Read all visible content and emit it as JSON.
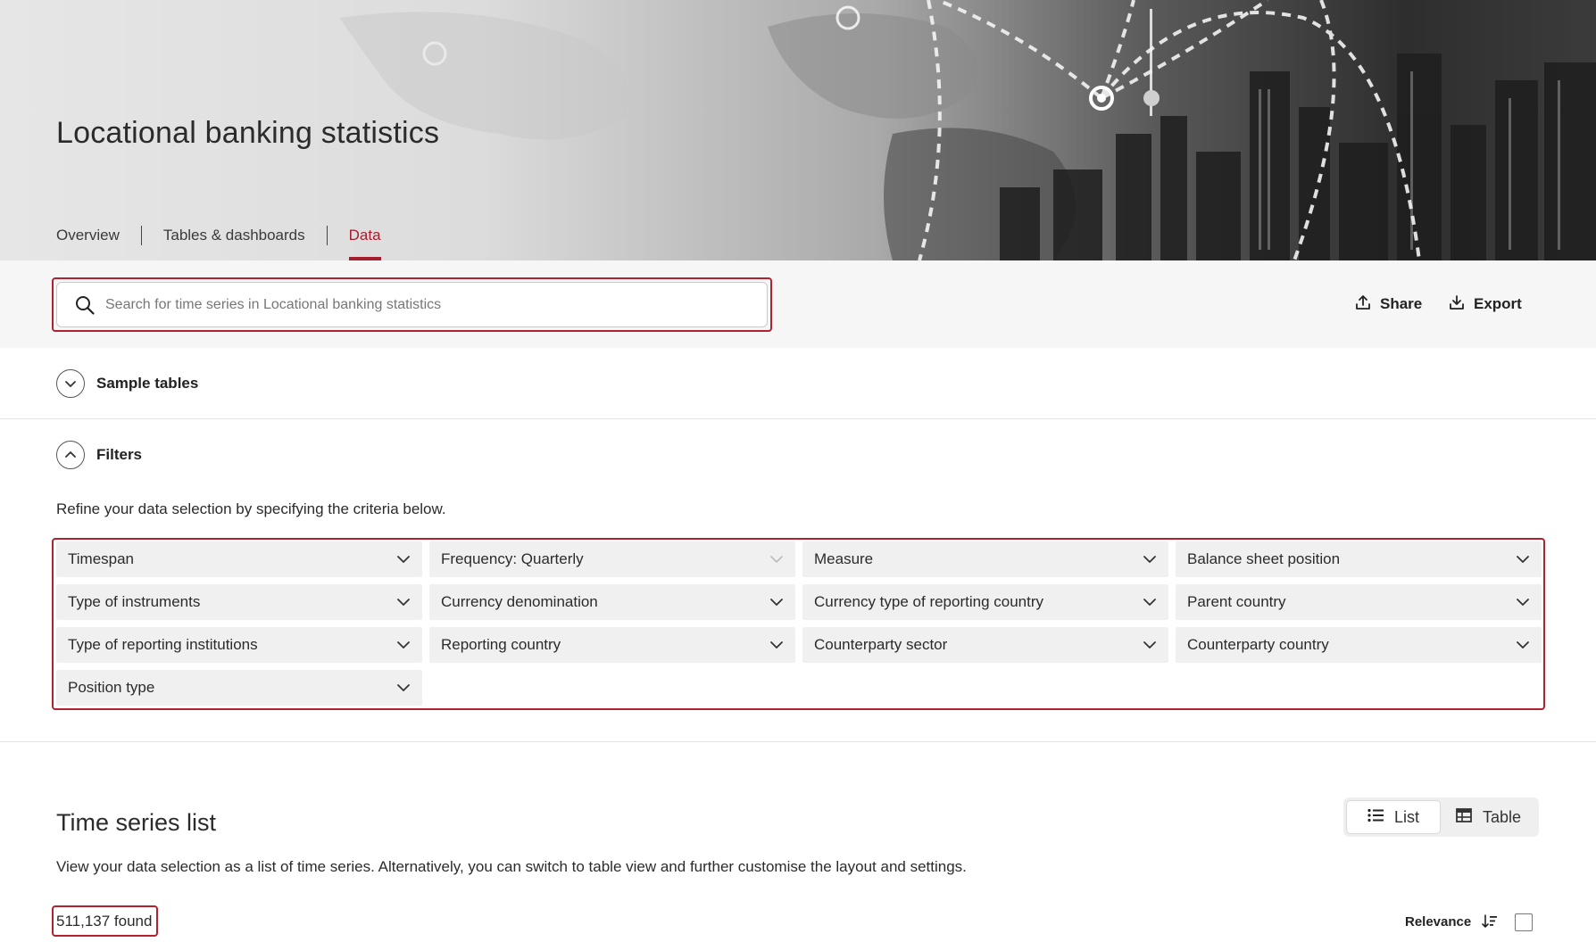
{
  "header": {
    "title": "Locational banking statistics",
    "tabs": [
      {
        "label": "Overview",
        "active": false
      },
      {
        "label": "Tables & dashboards",
        "active": false
      },
      {
        "label": "Data",
        "active": true
      }
    ]
  },
  "search": {
    "placeholder": "Search for time series in Locational banking statistics",
    "value": ""
  },
  "actions": {
    "share_label": "Share",
    "export_label": "Export"
  },
  "sample_tables": {
    "label": "Sample tables",
    "expanded": false
  },
  "filters": {
    "label": "Filters",
    "expanded": true,
    "description": "Refine your data selection by specifying the criteria below.",
    "items": [
      "Timespan",
      "Frequency: Quarterly",
      "Measure",
      "Balance sheet position",
      "Type of instruments",
      "Currency denomination",
      "Currency type of reporting country",
      "Parent country",
      "Type of reporting institutions",
      "Reporting country",
      "Counterparty sector",
      "Counterparty country",
      "Position type"
    ]
  },
  "time_series": {
    "title": "Time series list",
    "description": "View your data selection as a list of time series. Alternatively, you can switch to table view and further customise the layout and settings.",
    "views": {
      "list_label": "List",
      "table_label": "Table",
      "selected": "List"
    },
    "found_text": "511,137 found",
    "sort_label": "Relevance"
  },
  "colors": {
    "accent": "#a51e2e",
    "frame": "#b3202f",
    "band": "#f6f6f6",
    "filter_bg": "#f0f0f0"
  }
}
